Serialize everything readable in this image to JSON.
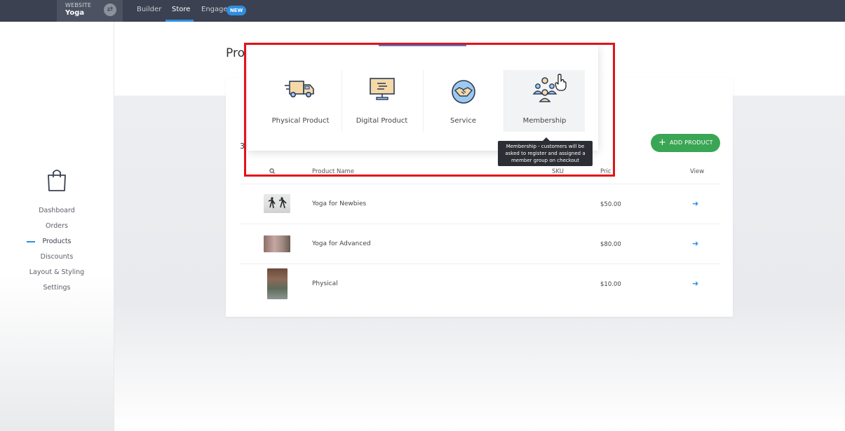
{
  "topbar": {
    "site_label": "WEBSITE",
    "site_name": "Yoga",
    "tabs": [
      {
        "label": "Builder"
      },
      {
        "label": "Store"
      },
      {
        "label": "Engage"
      }
    ],
    "new_badge": "NEW"
  },
  "sidebar": {
    "items": [
      {
        "label": "Dashboard"
      },
      {
        "label": "Orders"
      },
      {
        "label": "Products"
      },
      {
        "label": "Discounts"
      },
      {
        "label": "Layout & Styling"
      },
      {
        "label": "Settings"
      }
    ],
    "active": "Products"
  },
  "main": {
    "page_title": "Pro",
    "count": "3",
    "add_button": "ADD PRODUCT",
    "columns": [
      "Product Name",
      "SKU",
      "Pric",
      "View"
    ],
    "rows": [
      {
        "name": "Yoga for Newbies",
        "price": "$50.00"
      },
      {
        "name": "Yoga for Advanced",
        "price": "$80.00"
      },
      {
        "name": "Physical",
        "price": "$10.00"
      }
    ]
  },
  "popup": {
    "types": [
      {
        "label": "Physical Product",
        "icon": "delivery-truck-icon"
      },
      {
        "label": "Digital Product",
        "icon": "monitor-icon"
      },
      {
        "label": "Service",
        "icon": "handshake-icon"
      },
      {
        "label": "Membership",
        "icon": "members-group-icon"
      }
    ],
    "tooltip": "Membership - customers will be asked to register and assigned a member group on checkout"
  },
  "colors": {
    "topbar": "#3b4150",
    "accent": "#2f8ee0",
    "add_button": "#3aa655",
    "highlight_frame": "#e3121b"
  }
}
